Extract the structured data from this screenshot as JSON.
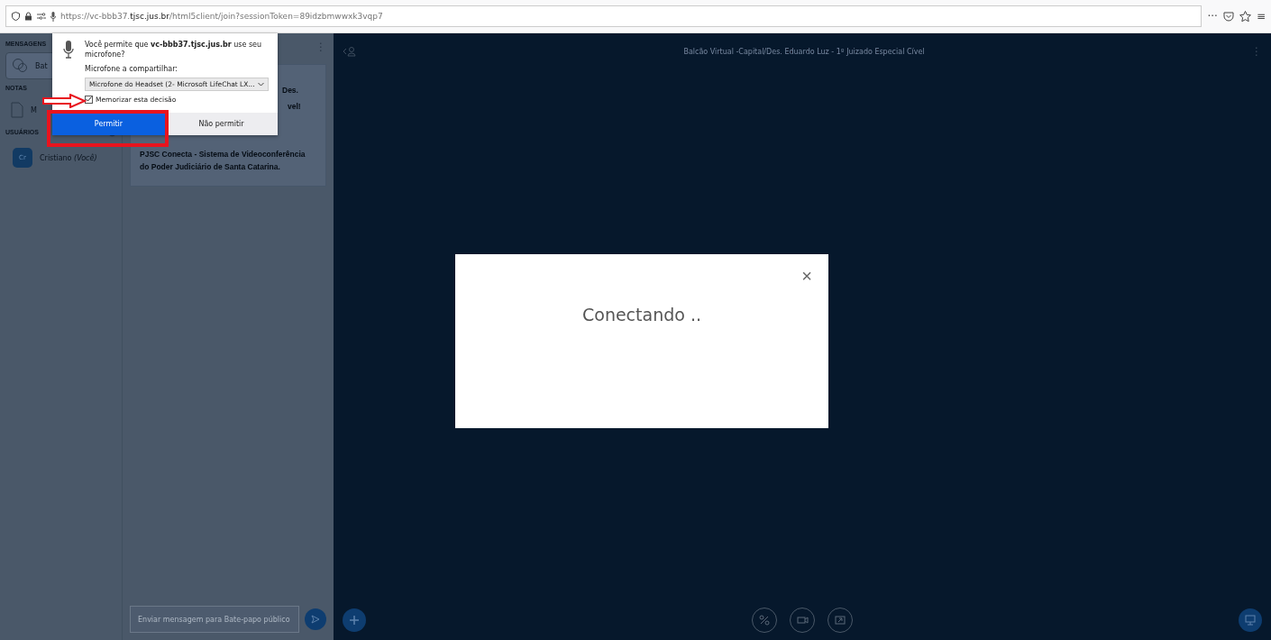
{
  "browser": {
    "url_prefix": "https://vc-bbb37.",
    "url_domain": "tjsc.jus.br",
    "url_suffix": "/html5client/join?sessionToken=89idzbmwwxk3vqp7",
    "menu_dots": "···",
    "menu_glyph": "≡"
  },
  "sidebar": {
    "messages_label": "MENSAGENS",
    "chat_item": "Bat",
    "notes_label": "NOTAS",
    "note_item": "M",
    "users_label": "USUÁRIOS",
    "users": [
      {
        "initials": "Cr",
        "name": "Cristiano *(Você)*"
      }
    ]
  },
  "chat": {
    "menu_glyph": "⋮",
    "fragments": [
      "Des.",
      "vel!"
    ],
    "welcome": "PJSC Conecta - Sistema de Videoconferência do Poder Judiciário de Santa Catarina.",
    "input_placeholder": "Enviar mensagem para Bate-papo público"
  },
  "main": {
    "title": "Balcão Virtual -Capital/Des. Eduardo Luz - 1º Juizado Especial Cível",
    "menu_glyph": "⋮"
  },
  "modal": {
    "message": "Conectando ..",
    "close": "×"
  },
  "permission_popup": {
    "question": "Você permite que **vc-bbb37.tjsc.jus.br** use seu microfone?",
    "device_label": "Microfone a compartilhar:",
    "device_value": "Microfone do Headset (2- Microsoft LifeChat LX...",
    "remember_label": "Memorizar esta decisão",
    "remember_checked": true,
    "buttons": [
      {
        "label": "Permitir",
        "primary": true
      },
      {
        "label": "Não permitir",
        "primary": false
      }
    ]
  }
}
